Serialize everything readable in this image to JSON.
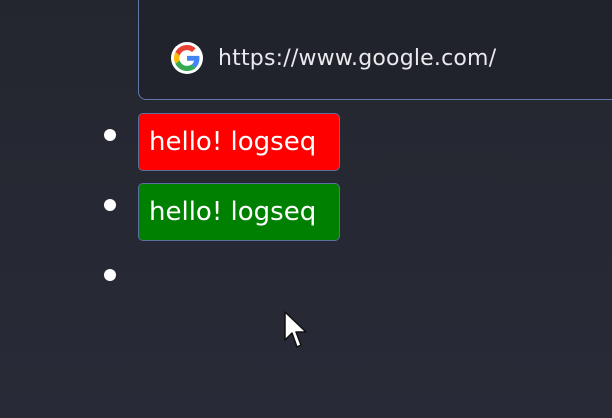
{
  "link_preview": {
    "url": "https://www.google.com/",
    "icon": "google-icon"
  },
  "blocks": [
    {
      "label": "hello! logseq",
      "background": "#ff0000"
    },
    {
      "label": "hello! logseq",
      "background": "#008000"
    },
    {
      "label": ""
    }
  ],
  "colors": {
    "page_background": "#282a36",
    "card_background": "#20222c",
    "card_border": "#5f78a8",
    "text": "#e9e9ee"
  },
  "cursor": "arrow-cursor"
}
